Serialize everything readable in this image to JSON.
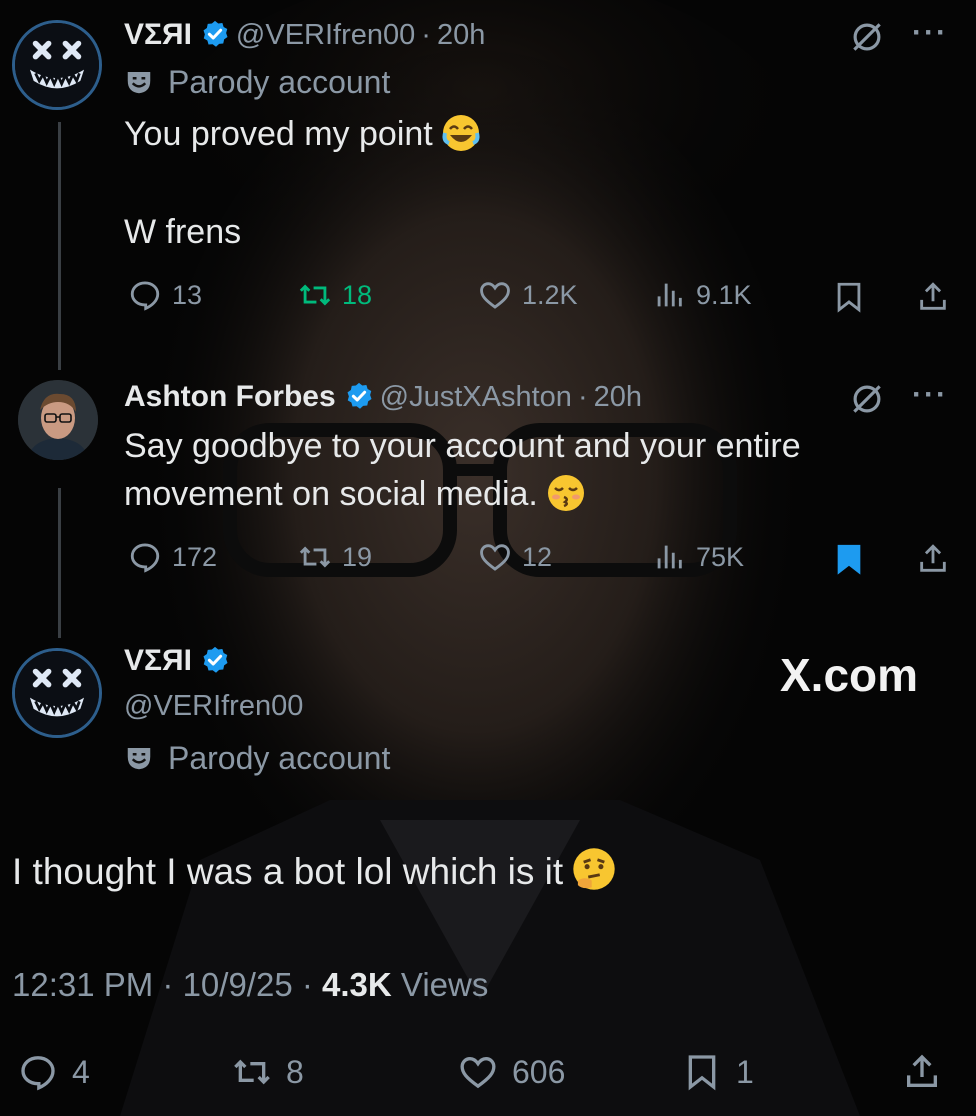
{
  "tweet1": {
    "name": "VΣЯI",
    "handle": "@VERIfren00",
    "time": "20h",
    "parody_label": "Parody account",
    "text_line1": "You proved my point",
    "text_line2": "W frens",
    "replies": "13",
    "reposts": "18",
    "likes": "1.2K",
    "views": "9.1K"
  },
  "tweet2": {
    "name": "Ashton Forbes",
    "handle": "@JustXAshton",
    "time": "20h",
    "text_line1": "Say goodbye to your account and your entire",
    "text_line2": "movement on social media.",
    "replies": "172",
    "reposts": "19",
    "likes": "12",
    "views": "75K"
  },
  "tweet3": {
    "name": "VΣЯI",
    "handle": "@VERIfren00",
    "parody_label": "Parody account",
    "text": "I thought I was a bot lol which is it",
    "timestamp": "12:31 PM · 10/9/25 · ",
    "views_count": "4.3K",
    "views_label": " Views",
    "replies": "4",
    "reposts": "8",
    "likes": "606",
    "bookmarks": "1"
  },
  "watermark": "X.com",
  "separator": "·",
  "more": "···",
  "icons": {
    "reply": "reply-icon",
    "repost": "repost-icon",
    "like": "heart-icon",
    "views": "views-icon",
    "bookmark": "bookmark-icon",
    "share": "share-icon",
    "grok": "grok-icon",
    "verified": "verified-badge-icon",
    "parody": "theater-mask-icon"
  },
  "colors": {
    "background": "#050505",
    "text": "#e7e9ea",
    "muted": "#8b98a5",
    "repost_active": "#00ba7c",
    "bookmark_active": "#1d9bf0",
    "verified": "#1d9bf0"
  }
}
